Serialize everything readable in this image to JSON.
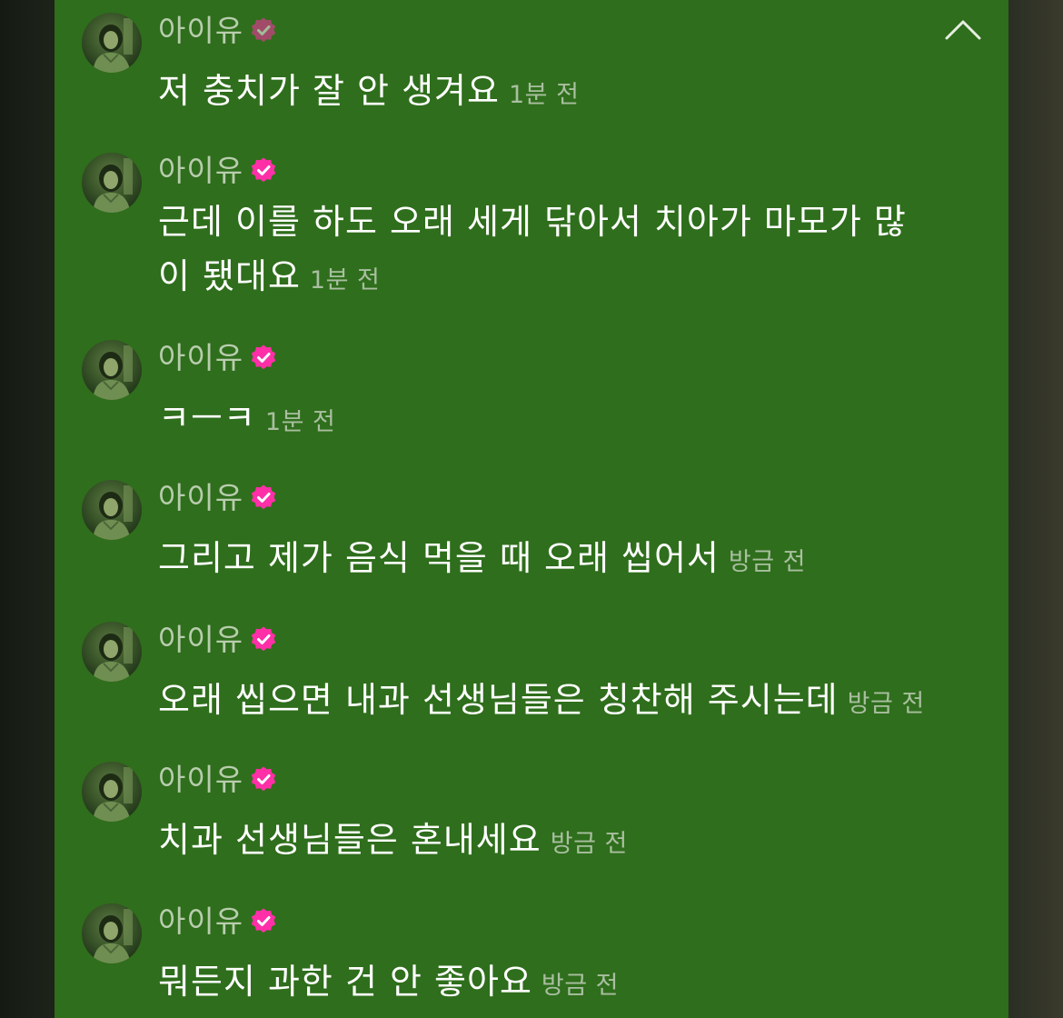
{
  "colors": {
    "panel_background": "#2f6e1c",
    "author_text": "#b8cdae",
    "message_text": "#ffffff",
    "timestamp_text": "#a9bfa0",
    "verified_badge": "#ff2fa8"
  },
  "icons": {
    "collapse": "chevron-up-icon",
    "verified": "verified-badge-icon",
    "avatar": "profile-avatar"
  },
  "messages": [
    {
      "author": "아이유",
      "text": "저 충치가 잘 안 생겨요",
      "text_line2": "",
      "time": "1분 전"
    },
    {
      "author": "아이유",
      "text": "근데 이를 하도 오래 세게 닦아서 치아가 마모가 많",
      "text_line2": "이 됐대요",
      "time": "1분 전"
    },
    {
      "author": "아이유",
      "text": "ㅋㅡㅋ",
      "text_line2": "",
      "time": "1분 전"
    },
    {
      "author": "아이유",
      "text": "그리고 제가 음식 먹을 때 오래 씹어서",
      "text_line2": "",
      "time": "방금 전"
    },
    {
      "author": "아이유",
      "text": "오래 씹으면 내과 선생님들은 칭찬해 주시는데",
      "text_line2": "",
      "time": "방금 전"
    },
    {
      "author": "아이유",
      "text": "치과 선생님들은 혼내세요",
      "text_line2": "",
      "time": "방금 전"
    },
    {
      "author": "아이유",
      "text": "뭐든지 과한 건 안 좋아요",
      "text_line2": "",
      "time": "방금 전"
    }
  ]
}
